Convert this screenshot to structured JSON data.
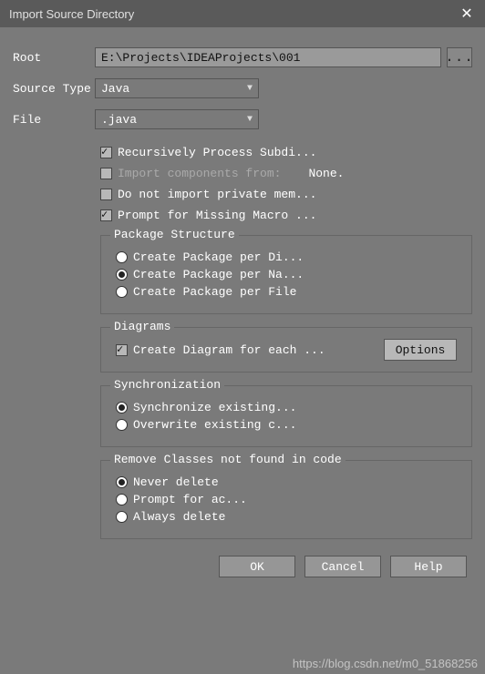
{
  "titlebar": {
    "title": "Import Source Directory"
  },
  "fields": {
    "root_label": "Root",
    "root_value": "E:\\Projects\\IDEAProjects\\001",
    "browse": "...",
    "source_type_label": "Source Type",
    "source_type_value": "Java",
    "file_label": "File",
    "file_value": ".java"
  },
  "checks": {
    "recurse": "Recursively Process Subdi...",
    "import_from": "Import components from:",
    "import_from_value": "None.",
    "no_private": "Do not import private mem...",
    "prompt_macro": "Prompt for Missing Macro ..."
  },
  "package": {
    "legend": "Package Structure",
    "per_dir": "Create Package per Di...",
    "per_name": "Create Package per Na...",
    "per_file": "Create Package per File"
  },
  "diagrams": {
    "legend": "Diagrams",
    "create": "Create Diagram for each ...",
    "options_btn": "Options"
  },
  "sync": {
    "legend": "Synchronization",
    "sync_existing": "Synchronize existing...",
    "overwrite": "Overwrite existing c..."
  },
  "remove": {
    "legend": "Remove Classes not found in code",
    "never": "Never delete",
    "prompt": "Prompt for ac...",
    "always": "Always delete"
  },
  "buttons": {
    "ok": "OK",
    "cancel": "Cancel",
    "help": "Help"
  },
  "watermark": "https://blog.csdn.net/m0_51868256"
}
